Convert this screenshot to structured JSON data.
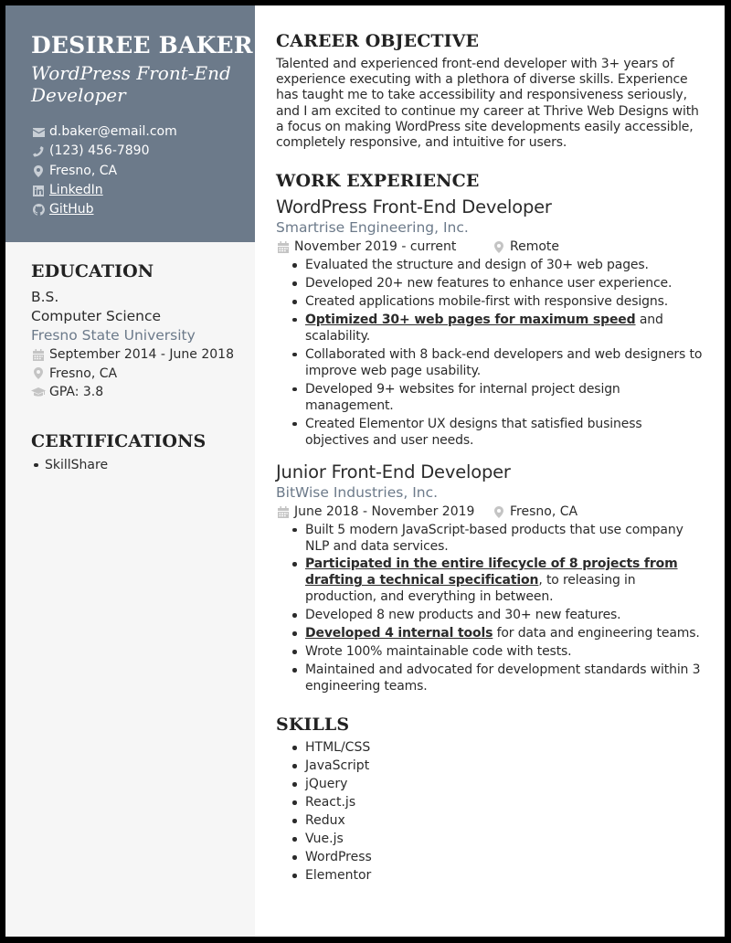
{
  "header": {
    "name": "DESIREE BAKER",
    "title": "WordPress Front-End Developer",
    "contacts": [
      {
        "icon": "envelope-icon",
        "text": "d.baker@email.com",
        "link": false
      },
      {
        "icon": "phone-icon",
        "text": "(123) 456-7890",
        "link": false
      },
      {
        "icon": "map-pin-icon",
        "text": "Fresno, CA",
        "link": false
      },
      {
        "icon": "linkedin-icon",
        "text": "LinkedIn",
        "link": true
      },
      {
        "icon": "github-icon",
        "text": "GitHub",
        "link": true
      }
    ]
  },
  "colors": {
    "accent": "#6c7a8a",
    "sidebar_bg": "#f6f6f6",
    "border": "#000000"
  },
  "education": {
    "heading": "EDUCATION",
    "degree": "B.S.",
    "field": "Computer Science",
    "school": "Fresno State University",
    "dates": "September 2014 - June 2018",
    "location": "Fresno, CA",
    "gpa": "GPA: 3.8"
  },
  "certifications": {
    "heading": "CERTIFICATIONS",
    "items": [
      "SkillShare"
    ]
  },
  "objective": {
    "heading": "CAREER OBJECTIVE",
    "text": "Talented and experienced front-end developer with 3+ years of experience executing with a plethora of diverse skills. Experience has taught me to take accessibility and responsiveness seriously, and I am excited to continue my career at Thrive Web Designs with a focus on making WordPress site developments easily accessible, completely responsive, and intuitive for users."
  },
  "experience": {
    "heading": "WORK EXPERIENCE",
    "jobs": [
      {
        "title": "WordPress Front-End Developer",
        "company": "Smartrise Engineering, Inc.",
        "dates": "November 2019 - current",
        "location": "Remote",
        "bullets": [
          {
            "emph": "",
            "rest": "Evaluated the structure and design of 30+ web pages."
          },
          {
            "emph": "",
            "rest": "Developed 20+ new features to enhance user experience."
          },
          {
            "emph": "",
            "rest": "Created applications mobile-first with responsive designs."
          },
          {
            "emph": "Optimized 30+ web pages for maximum speed",
            "rest": " and scalability."
          },
          {
            "emph": "",
            "rest": "Collaborated with 8 back-end developers and web designers to improve web page usability."
          },
          {
            "emph": "",
            "rest": "Developed 9+ websites for internal project design management."
          },
          {
            "emph": "",
            "rest": "Created Elementor UX designs that satisfied business objectives and user needs."
          }
        ]
      },
      {
        "title": "Junior Front-End Developer",
        "company": "BitWise Industries, Inc.",
        "dates": "June 2018 - November 2019",
        "location": "Fresno, CA",
        "bullets": [
          {
            "emph": "",
            "rest": "Built 5 modern JavaScript-based products that use company NLP and data services."
          },
          {
            "emph": "Participated in the entire lifecycle of 8 projects from drafting a technical specification",
            "rest": ", to releasing in production, and everything in between."
          },
          {
            "emph": "",
            "rest": "Developed 8 new products and 30+ new features."
          },
          {
            "emph": "Developed 4 internal tools",
            "rest": " for data and engineering teams."
          },
          {
            "emph": "",
            "rest": "Wrote 100% maintainable code with tests."
          },
          {
            "emph": "",
            "rest": "Maintained and advocated for development standards within 3 engineering teams."
          }
        ]
      }
    ]
  },
  "skills": {
    "heading": "SKILLS",
    "items": [
      "HTML/CSS",
      "JavaScript",
      "jQuery",
      "React.js",
      "Redux",
      "Vue.js",
      "WordPress",
      "Elementor"
    ]
  }
}
